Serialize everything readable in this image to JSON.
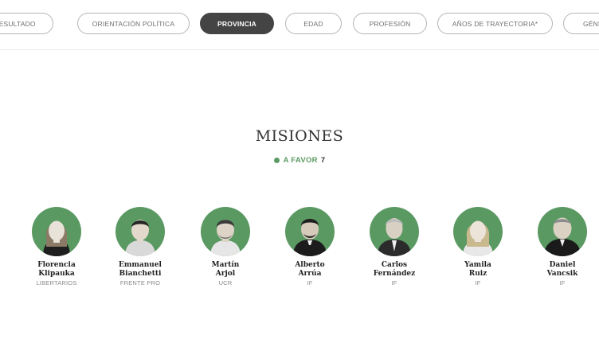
{
  "filters": {
    "tabs": [
      {
        "label": "RESULTADO",
        "active": false
      },
      {
        "label": "ORIENTACIÓN POLÍTICA",
        "active": false
      },
      {
        "label": "PROVINCIA",
        "active": true
      },
      {
        "label": "EDAD",
        "active": false
      },
      {
        "label": "PROFESIÓN",
        "active": false
      },
      {
        "label": "AÑOS DE TRAYECTORIA*",
        "active": false
      },
      {
        "label": "GÉNE",
        "active": false
      }
    ]
  },
  "section": {
    "province": "MISIONES",
    "vote_label": "A FAVOR",
    "vote_count": "7",
    "vote_color": "#5b9a63"
  },
  "legislators": [
    {
      "first": "Florencia",
      "last": "Klipauka",
      "party": "LIBERTARIOS"
    },
    {
      "first": "Emmanuel",
      "last": "Bianchetti",
      "party": "FRENTE PRO"
    },
    {
      "first": "Martín",
      "last": "Arjol",
      "party": "UCR"
    },
    {
      "first": "Alberto",
      "last": "Arrúa",
      "party": "IF"
    },
    {
      "first": "Carlos",
      "last": "Fernández",
      "party": "IF"
    },
    {
      "first": "Yamila",
      "last": "Ruiz",
      "party": "IF"
    },
    {
      "first": "Daniel",
      "last": "Vancsik",
      "party": "IF"
    }
  ],
  "colors": {
    "avatar_bg": "#5a9962",
    "active_tab_bg": "#444444"
  }
}
